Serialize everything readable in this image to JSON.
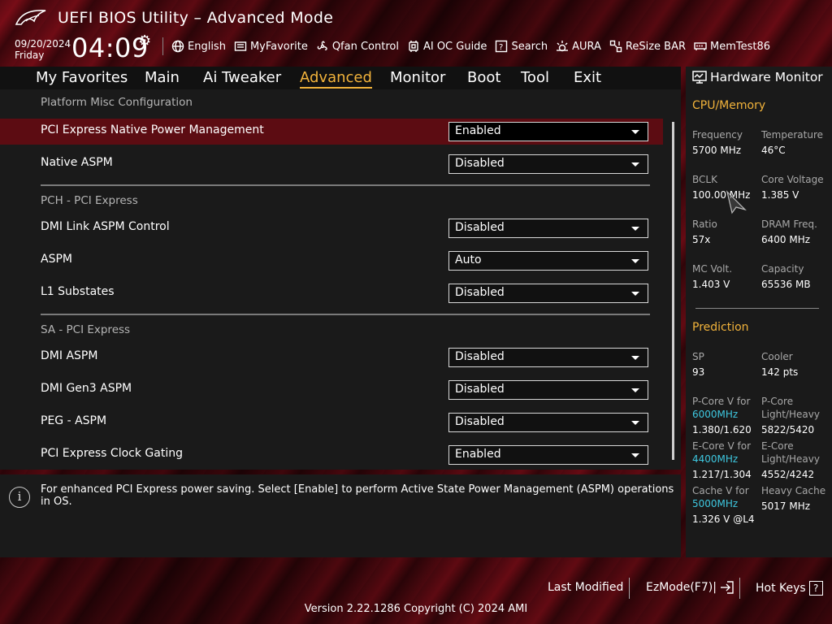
{
  "header": {
    "title": "UEFI BIOS Utility – Advanced Mode",
    "date": "09/20/2024",
    "day": "Friday",
    "time": "04:09",
    "toolbar": [
      {
        "label": "English",
        "icon": "globe-icon"
      },
      {
        "label": "MyFavorite",
        "icon": "favorite-icon"
      },
      {
        "label": "Qfan Control",
        "icon": "fan-icon"
      },
      {
        "label": "AI OC Guide",
        "icon": "ai-guide-icon"
      },
      {
        "label": "Search",
        "icon": "search-icon"
      },
      {
        "label": "AURA",
        "icon": "aura-icon"
      },
      {
        "label": "ReSize BAR",
        "icon": "resize-bar-icon"
      },
      {
        "label": "MemTest86",
        "icon": "memtest-icon"
      }
    ]
  },
  "nav": {
    "tabs": [
      "My Favorites",
      "Main",
      "Ai Tweaker",
      "Advanced",
      "Monitor",
      "Boot",
      "Tool",
      "Exit"
    ],
    "active": "Advanced"
  },
  "main": {
    "sections": [
      {
        "title": "Platform Misc Configuration"
      },
      {
        "title": "PCH - PCI Express"
      },
      {
        "title": "SA - PCI Express"
      }
    ],
    "rows": [
      {
        "label": "PCI Express Native Power Management",
        "value": "Enabled"
      },
      {
        "label": "Native ASPM",
        "value": "Disabled"
      },
      {
        "label": "DMI Link ASPM Control",
        "value": "Disabled"
      },
      {
        "label": "ASPM",
        "value": "Auto"
      },
      {
        "label": "L1 Substates",
        "value": "Disabled"
      },
      {
        "label": "DMI ASPM",
        "value": "Disabled"
      },
      {
        "label": "DMI Gen3 ASPM",
        "value": "Disabled"
      },
      {
        "label": "PEG - ASPM",
        "value": "Disabled"
      },
      {
        "label": "PCI Express Clock Gating",
        "value": "Enabled"
      }
    ]
  },
  "help": {
    "text": "For enhanced PCI Express power saving. Select [Enable] to perform Active State Power Management (ASPM) operations in OS."
  },
  "hw": {
    "title": "Hardware Monitor",
    "cpu_section": "CPU/Memory",
    "cpu": [
      {
        "label": "Frequency",
        "value": "5700 MHz"
      },
      {
        "label": "Temperature",
        "value": "46°C"
      },
      {
        "label": "BCLK",
        "value": "100.00 MHz"
      },
      {
        "label": "Core Voltage",
        "value": "1.385 V"
      },
      {
        "label": "Ratio",
        "value": "57x"
      },
      {
        "label": "DRAM Freq.",
        "value": "6400 MHz"
      },
      {
        "label": "MC Volt.",
        "value": "1.403 V"
      },
      {
        "label": "Capacity",
        "value": "65536 MB"
      }
    ],
    "pred_section": "Prediction",
    "pred": {
      "sp_label": "SP",
      "sp_value": "93",
      "cooler_label": "Cooler",
      "cooler_value": "142 pts",
      "pcore_v_label": "P-Core V for",
      "pcore_v_freq": "6000MHz",
      "pcore_v_value": "1.380/1.620",
      "pcore_lh_label1": "P-Core",
      "pcore_lh_label2": "Light/Heavy",
      "pcore_lh_value": "5822/5420",
      "ecore_v_label": "E-Core V for",
      "ecore_v_freq": "4400MHz",
      "ecore_v_value": "1.217/1.304",
      "ecore_lh_label1": "E-Core",
      "ecore_lh_label2": "Light/Heavy",
      "ecore_lh_value": "4552/4242",
      "cache_v_label": "Cache V for",
      "cache_v_freq": "5000MHz",
      "cache_v_value": "1.326 V @L4",
      "heavy_cache_label": "Heavy Cache",
      "heavy_cache_value": "5017 MHz"
    }
  },
  "footer": {
    "last_modified": "Last Modified",
    "ezmode": "EzMode(F7)|",
    "hotkeys": "Hot Keys",
    "hotkeys_key": "?",
    "version": "Version 2.22.1286 Copyright (C) 2024 AMI"
  },
  "colors": {
    "accent": "#f2b33b",
    "highlight_row": "#5c0c12",
    "cyan": "#3ec8e0",
    "panel": "#1a1a1a"
  }
}
